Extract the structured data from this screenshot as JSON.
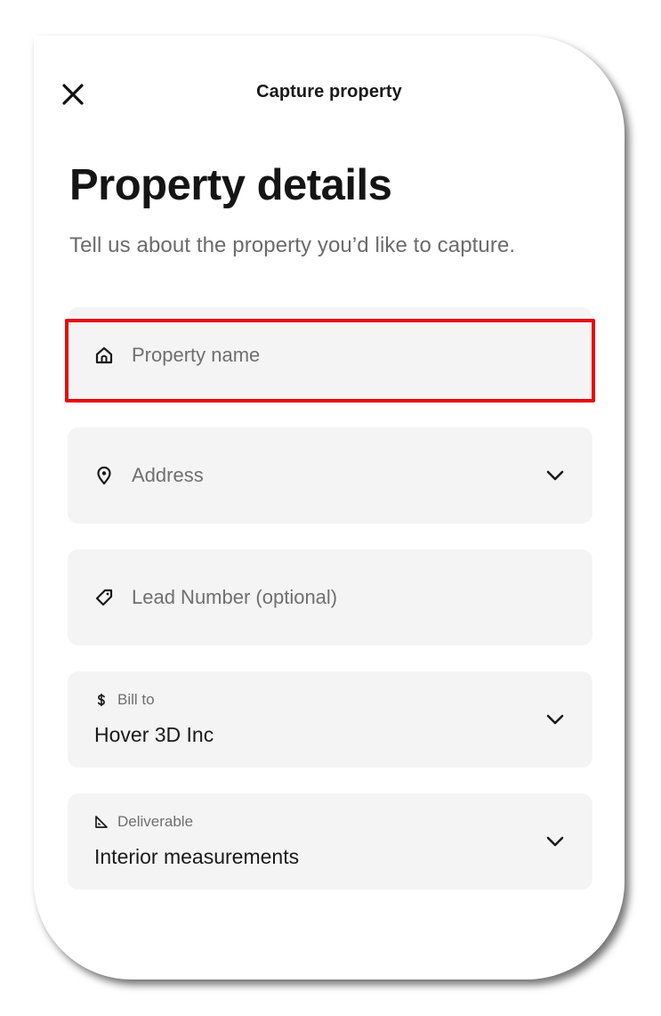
{
  "header": {
    "title": "Capture property",
    "close_icon": "close-icon"
  },
  "page": {
    "title": "Property details",
    "subtitle": "Tell us about the property you’d like to capture."
  },
  "form": {
    "property_name": {
      "placeholder": "Property name",
      "icon": "house-icon"
    },
    "address": {
      "placeholder": "Address",
      "icon": "map-pin-icon"
    },
    "lead_number": {
      "placeholder": "Lead Number (optional)",
      "icon": "tag-icon"
    },
    "bill_to": {
      "label": "Bill to",
      "value": "Hover 3D Inc",
      "icon": "dollar-icon"
    },
    "deliverable": {
      "label": "Deliverable",
      "value": "Interior measurements",
      "icon": "ruler-triangle-icon"
    }
  },
  "colors": {
    "highlight": "#e8090c",
    "field_bg": "#f4f4f4",
    "text_primary": "#151515",
    "text_secondary": "#6b6b6b"
  }
}
